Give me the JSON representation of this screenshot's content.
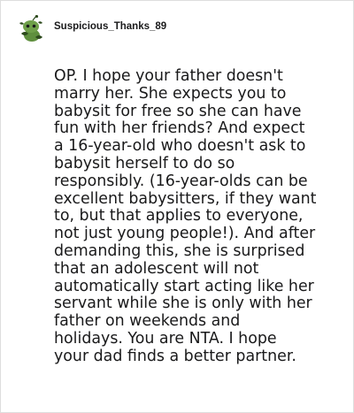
{
  "comment": {
    "username": "Suspicious_Thanks_89",
    "avatar_icon": "snoo-avatar-icon",
    "lines": [
      "OP. I hope your father doesn't",
      "marry her. She expects you to",
      "babysit for free so she can have",
      "fun with her friends? And expect",
      "a 16-year-old who doesn't ask to",
      "babysit herself to do so",
      "responsibly. (16-year-olds can be",
      "excellent babysitters, if they want",
      "to, but that applies to everyone,",
      "not just young people!). And after",
      "demanding this, she is surprised",
      "that an adolescent will not",
      "automatically start acting like her",
      "servant while she is only with her",
      "father on weekends and",
      "holidays. You are NTA. I hope",
      "your dad finds a better partner."
    ]
  },
  "colors": {
    "text": "#1a1a1b",
    "border": "#dedede",
    "avatar_green": "#5f8f3e",
    "avatar_dark": "#2d4a1d"
  }
}
